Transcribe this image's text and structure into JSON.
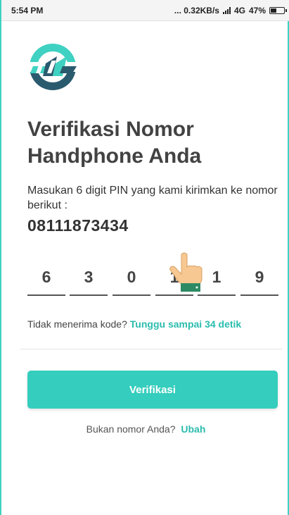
{
  "status_bar": {
    "time": "5:54 PM",
    "network": "... 0.32KB/s",
    "signal": "4G",
    "battery": "47%"
  },
  "header": {
    "title_line1": "Verifikasi Nomor",
    "title_line2": "Handphone Anda"
  },
  "instructions": "Masukan 6 digit PIN yang kami kirimkan ke nomor berikut :",
  "phone_number": "08111873434",
  "pin": {
    "digits": [
      "6",
      "3",
      "0",
      "1",
      "1",
      "9"
    ]
  },
  "resend": {
    "question": "Tidak menerima kode?",
    "timer_text": "Tunggu sampai 34 detik"
  },
  "verify_button": "Verifikasi",
  "change_number": {
    "question": "Bukan nomor Anda?",
    "link": "Ubah"
  },
  "colors": {
    "accent": "#35cdbd",
    "accent_text": "#2bbcae",
    "logo_dark": "#2a5a6e"
  },
  "icons": [
    "app-logo",
    "signal-icon",
    "battery-icon",
    "pointer-hand-icon"
  ]
}
